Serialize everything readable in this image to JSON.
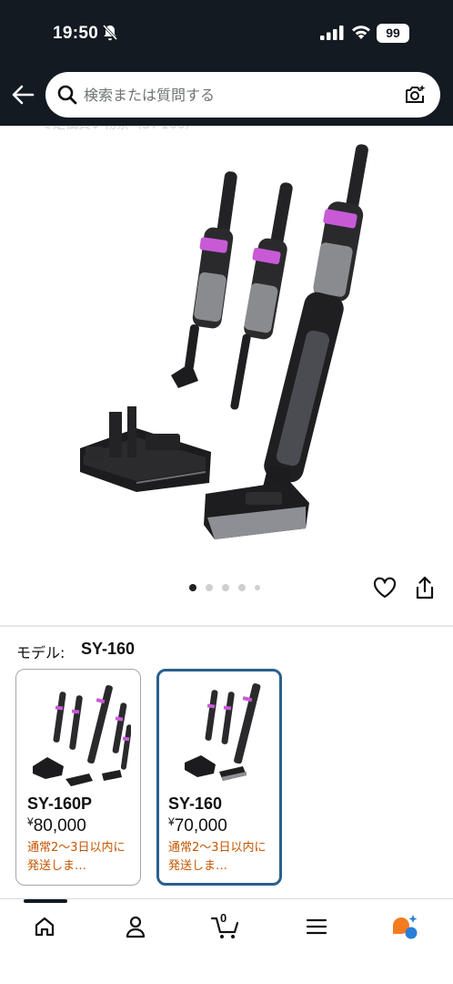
{
  "status_bar": {
    "time": "19:50",
    "battery": "99"
  },
  "search": {
    "placeholder": "検索または質問する"
  },
  "gallery": {
    "breadcrumb_partial": "一で定価買い物累（SY-160）",
    "image_count": 5,
    "active_index": 0
  },
  "model": {
    "label": "モデル:",
    "value": "SY-160"
  },
  "options": [
    {
      "name": "SY-160P",
      "currency": "¥",
      "price": "80,000",
      "shipping": "通常2〜3日以内に発送しま…",
      "selected": false
    },
    {
      "name": "SY-160",
      "currency": "¥",
      "price": "70,000",
      "shipping": "通常2〜3日以内に発送しま…",
      "selected": true
    }
  ],
  "bottom_nav": {
    "items": [
      "home-icon",
      "account-icon",
      "cart-icon",
      "menu-icon",
      "assistant-icon"
    ],
    "cart_count": "0",
    "active": "home-icon"
  },
  "colors": {
    "header_bg": "#131a22",
    "shipping_text": "#c45500",
    "selected_border": "#2a5f8f",
    "accent_purple": "#c95ad6"
  }
}
